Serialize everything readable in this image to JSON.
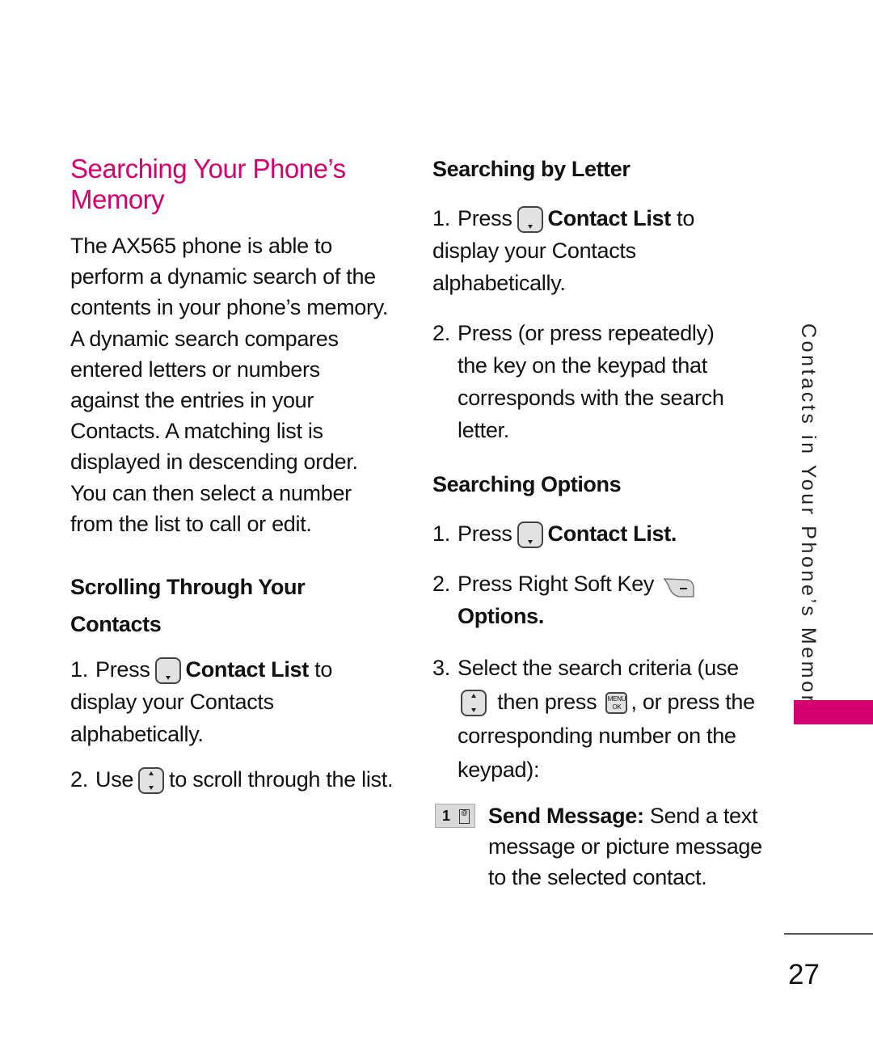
{
  "page": {
    "title": "Searching Your Phone’s Memory",
    "intro": "The AX565 phone is able to perform a dynamic search of the contents in your phone’s memory. A dynamic search compares entered letters or numbers against the entries in your Contacts. A matching list is displayed in descending order. You can then select a number from the list to call or edit.",
    "accent_color": "#d6006f",
    "side_tab": "Contacts in Your Phone’s Memory",
    "page_number": "27"
  },
  "scrolling": {
    "heading": "Scrolling Through Your Contacts",
    "steps": [
      {
        "num": "1.",
        "pre": "Press",
        "icon": "down-nav-key-icon",
        "bold": "Contact List",
        "post": "to display your Contacts alphabetically."
      },
      {
        "num": "2.",
        "pre": "Use",
        "icon": "up-down-nav-key-icon",
        "post": "to scroll through the list."
      }
    ]
  },
  "by_letter": {
    "heading": "Searching by Letter",
    "steps": [
      {
        "num": "1.",
        "pre": "Press",
        "icon": "down-nav-key-icon",
        "bold": "Contact List",
        "post": "to display your Contacts alphabetically."
      },
      {
        "num": "2.",
        "text": "Press (or press repeatedly) the key on the keypad that corresponds with the search letter."
      }
    ]
  },
  "options": {
    "heading": "Searching Options",
    "steps": [
      {
        "num": "1.",
        "pre": "Press",
        "icon": "down-nav-key-icon",
        "bold": "Contact List."
      },
      {
        "num": "2.",
        "pre": "Press Right Soft Key",
        "icon": "right-soft-key-icon",
        "bold": "Options."
      },
      {
        "num": "3.",
        "pre": "Select the search criteria (use",
        "mid": "then press",
        "icon2": "menu-ok-key-icon",
        "menu_top": "MENU",
        "menu_bottom": "OK",
        "post": ", or press the corresponding number on the keypad):"
      }
    ],
    "choice": {
      "key": "1",
      "bold": "Send Message:",
      "text": "Send a text message or picture message to the selected contact."
    }
  }
}
